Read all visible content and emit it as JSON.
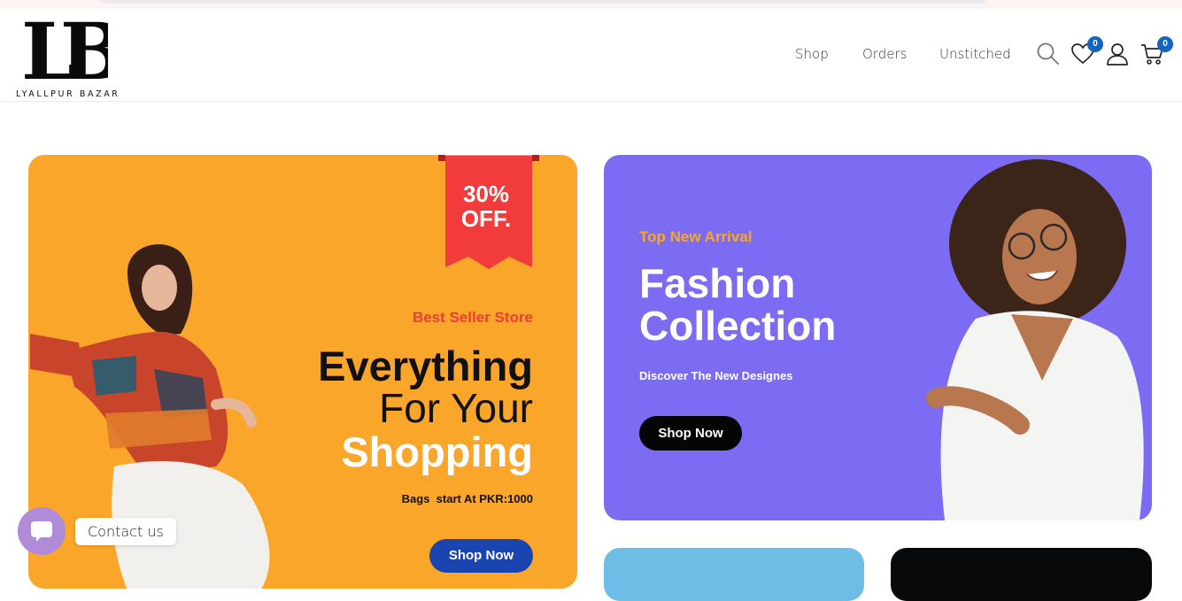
{
  "brand": {
    "monogram": "LB",
    "name": "LYALLPUR BAZAR"
  },
  "nav": {
    "items": [
      "Shop",
      "Orders",
      "Unstitched"
    ]
  },
  "header_icons": {
    "wishlist_count": "0",
    "cart_count": "0"
  },
  "banner_left": {
    "ribbon_line1": "30%",
    "ribbon_line2": "OFF.",
    "subtitle": "Best Seller Store",
    "line1": "Everything",
    "line2": "For Your",
    "line3": "Shopping",
    "note": "Bags  start At PKR:1000",
    "button": "Shop Now",
    "bg_color": "#f9a62b"
  },
  "banner_right": {
    "subtitle": "Top New Arrival",
    "title_line1": "Fashion",
    "title_line2": "Collection",
    "note": "Discover The New Designes",
    "button": "Shop Now",
    "bg_color": "#7b6cf3"
  },
  "contact": {
    "label": "Contact us"
  }
}
